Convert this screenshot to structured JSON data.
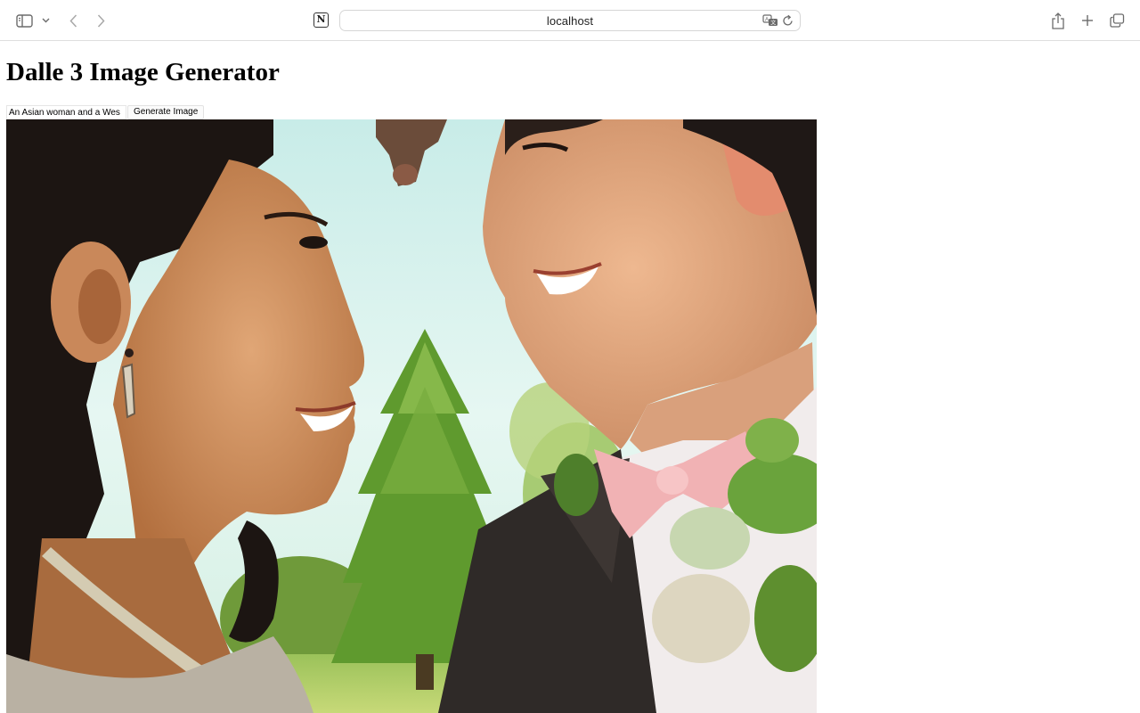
{
  "browser": {
    "address_bar": {
      "url_text": "localhost"
    },
    "icons": {
      "sidebar": "sidebar-icon",
      "chevron": "chevron-down-icon",
      "back": "back-arrow-icon",
      "forward": "forward-arrow-icon",
      "extension": "notion-icon",
      "translate": "translate-icon",
      "reload": "reload-icon",
      "share": "share-icon",
      "new_tab": "plus-icon",
      "tabs": "tab-overview-icon"
    }
  },
  "page": {
    "title": "Dalle 3 Image Generator",
    "form": {
      "prompt_value": "An Asian woman and a Wes",
      "generate_label": "Generate Image"
    }
  }
}
